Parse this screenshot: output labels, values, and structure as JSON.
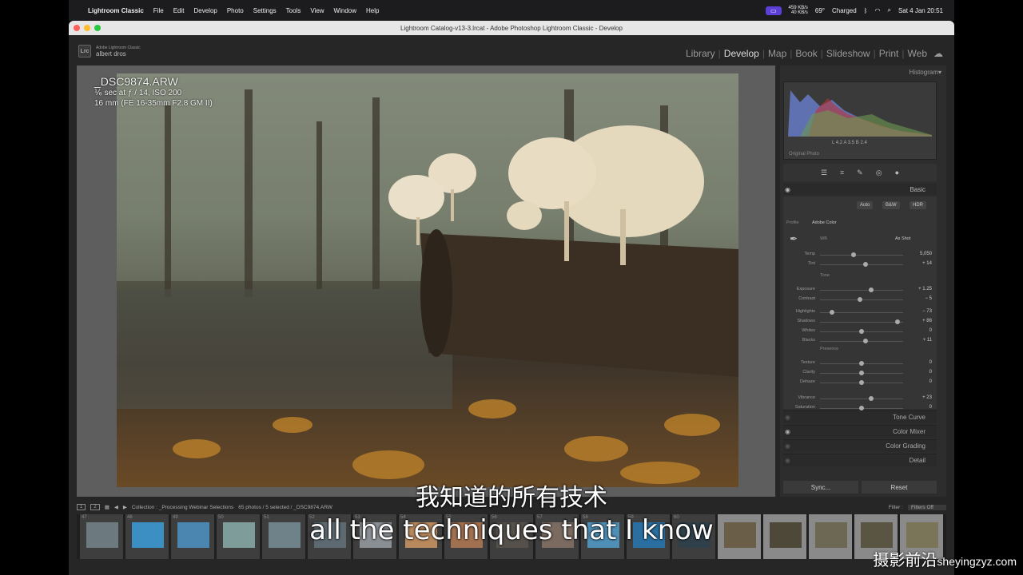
{
  "menubar": {
    "app": "Lightroom Classic",
    "items": [
      "File",
      "Edit",
      "Develop",
      "Photo",
      "Settings",
      "Tools",
      "View",
      "Window",
      "Help"
    ],
    "net_up": "459 KB/s",
    "net_down": "40 KB/s",
    "temp": "69°",
    "battery": "Charged",
    "datetime": "Sat 4 Jan  20:51"
  },
  "window": {
    "title": "Lightroom Catalog-v13-3.lrcat - Adobe Photoshop Lightroom Classic - Develop"
  },
  "identity": {
    "logo": "Lrc",
    "sub": "Adobe Lightroom Classic",
    "user": "albert dros"
  },
  "modules": {
    "items": [
      "Library",
      "Develop",
      "Map",
      "Book",
      "Slideshow",
      "Print",
      "Web"
    ],
    "active": "Develop"
  },
  "photo": {
    "filename": "_DSC9874.ARW",
    "exposure": "⅙ sec at ƒ / 14, ISO 200",
    "lens": "16 mm (FE 16-35mm F2.8 GM II)"
  },
  "histogram": {
    "title": "Histogram",
    "values": "L  4.2  A  3.5  B  2.4",
    "original": "Original Photo"
  },
  "basic": {
    "title": "Basic",
    "buttons": [
      "Auto",
      "B&W",
      "HDR"
    ],
    "profile_label": "Profile",
    "profile": "Adobe Color",
    "wb_label": "WB",
    "wb": "As Shot",
    "tone_label": "Tone",
    "presence_label": "Presence",
    "sliders": [
      {
        "label": "Temp",
        "value": "5,050",
        "pos": 0.4
      },
      {
        "label": "Tint",
        "value": "+ 14",
        "pos": 0.55
      },
      {
        "label": "Exposure",
        "value": "+ 1.25",
        "pos": 0.62
      },
      {
        "label": "Contrast",
        "value": "− 5",
        "pos": 0.48
      },
      {
        "label": "Highlights",
        "value": "− 73",
        "pos": 0.14
      },
      {
        "label": "Shadows",
        "value": "+ 86",
        "pos": 0.93
      },
      {
        "label": "Whites",
        "value": "0",
        "pos": 0.5
      },
      {
        "label": "Blacks",
        "value": "+ 11",
        "pos": 0.55
      },
      {
        "label": "Texture",
        "value": "0",
        "pos": 0.5
      },
      {
        "label": "Clarity",
        "value": "0",
        "pos": 0.5
      },
      {
        "label": "Dehaze",
        "value": "0",
        "pos": 0.5
      },
      {
        "label": "Vibrance",
        "value": "+ 23",
        "pos": 0.62
      },
      {
        "label": "Saturation",
        "value": "0",
        "pos": 0.5
      }
    ]
  },
  "panels": [
    "Tone Curve",
    "Color Mixer",
    "Color Grading",
    "Detail"
  ],
  "actions": {
    "sync": "Sync...",
    "reset": "Reset"
  },
  "filmbar": {
    "pages": [
      "1",
      "2"
    ],
    "collection": "Collection : _Processing Webinar Selections",
    "count": "65 photos / 5 selected / _DSC9874.ARW",
    "filter_label": "Filter :",
    "filter": "Filters Off"
  },
  "film": [
    "47",
    "48",
    "49",
    "50",
    "51",
    "52",
    "53",
    "54",
    "55",
    "56",
    "57",
    "58",
    "59",
    "60",
    "61",
    "62",
    "63",
    "64",
    "65"
  ],
  "subtitles": {
    "cn": "我知道的所有技术",
    "en": "all the techniques that I know"
  },
  "watermark": {
    "cn": "摄影前沿",
    "url": "sheyingzyz.com"
  }
}
